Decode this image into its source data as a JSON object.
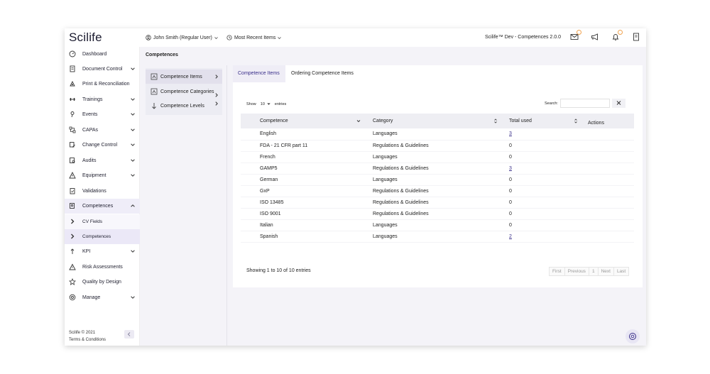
{
  "app": {
    "logo": "Scilife",
    "user": "John Smith (Regular User)",
    "recent": "Most Recent Items",
    "title": "Scilife™ Dev - Competences 2.0.0"
  },
  "sidebar": {
    "items": [
      {
        "label": "Dashboard",
        "icon": "gauge-icon"
      },
      {
        "label": "Document Control",
        "icon": "document-icon"
      },
      {
        "label": "Print & Reconciliation",
        "icon": "print-icon"
      },
      {
        "label": "Trainings",
        "icon": "barbell-icon"
      },
      {
        "label": "Events",
        "icon": "pin-icon"
      },
      {
        "label": "CAPAs",
        "icon": "network-icon"
      },
      {
        "label": "Change Control",
        "icon": "change-icon"
      },
      {
        "label": "Audits",
        "icon": "audit-icon"
      },
      {
        "label": "Equipment",
        "icon": "equipment-icon"
      },
      {
        "label": "Validations",
        "icon": "clipboard-check-icon"
      },
      {
        "label": "Competences",
        "icon": "competence-icon"
      },
      {
        "label": "CV Fields",
        "icon": "chevron-right-icon"
      },
      {
        "label": "Competences",
        "icon": "chevron-right-icon"
      },
      {
        "label": "KPI",
        "icon": "kpi-icon"
      },
      {
        "label": "Risk Assessments",
        "icon": "warning-icon"
      },
      {
        "label": "Quality by Design",
        "icon": "quality-icon"
      },
      {
        "label": "Manage",
        "icon": "settings-icon"
      }
    ],
    "footer": {
      "copyright": "Scilife © 2021",
      "terms": "Terms & Conditions"
    }
  },
  "page": {
    "title": "Competences",
    "submenu": [
      {
        "label": "Competence Items"
      },
      {
        "label": "Competence Categories"
      },
      {
        "label": "Competence Levels"
      }
    ],
    "tabs": [
      {
        "label": "Competence Items"
      },
      {
        "label": "Ordering Competence Items"
      }
    ]
  },
  "table_controls": {
    "show_label": "Show",
    "entries_value": "10",
    "entries_label": "entries",
    "search_label": "Search:"
  },
  "table": {
    "headers": [
      "Competence",
      "Category",
      "Total used",
      "Actions"
    ],
    "rows": [
      {
        "competence": "English",
        "category": "Languages",
        "total": "3",
        "link": true
      },
      {
        "competence": "FDA - 21 CFR part 11",
        "category": "Regulations & Guidelines",
        "total": "0",
        "link": false
      },
      {
        "competence": "French",
        "category": "Languages",
        "total": "0",
        "link": false
      },
      {
        "competence": "GAMP5",
        "category": "Regulations & Guidelines",
        "total": "3",
        "link": true
      },
      {
        "competence": "German",
        "category": "Languages",
        "total": "0",
        "link": false
      },
      {
        "competence": "GxP",
        "category": "Regulations & Guidelines",
        "total": "0",
        "link": false
      },
      {
        "competence": "ISO 13485",
        "category": "Regulations & Guidelines",
        "total": "0",
        "link": false
      },
      {
        "competence": "ISO 9001",
        "category": "Regulations & Guidelines",
        "total": "0",
        "link": false
      },
      {
        "competence": "Italian",
        "category": "Languages",
        "total": "0",
        "link": false
      },
      {
        "competence": "Spanish",
        "category": "Languages",
        "total": "2",
        "link": true
      }
    ],
    "info": "Showing 1 to 10 of 10 entries",
    "pager": [
      "First",
      "Previous",
      "1",
      "Next",
      "Last"
    ]
  },
  "colors": {
    "accent": "#3a2f8a",
    "badge": "#f0a350"
  }
}
